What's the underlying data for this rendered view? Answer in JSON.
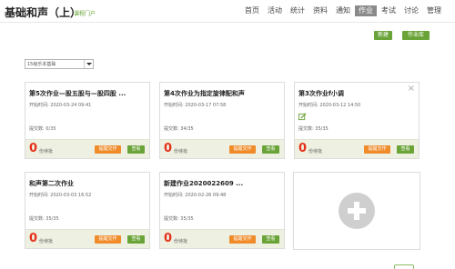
{
  "header": {
    "title": "基础和声（上）",
    "portal_link": "课程门户",
    "nav": [
      "首页",
      "活动",
      "统计",
      "资料",
      "通知",
      "作业",
      "考试",
      "讨论",
      "管理"
    ],
    "active_nav": "作业"
  },
  "toolbar": {
    "new_button": "新建",
    "library_button": "作业库"
  },
  "filter": {
    "selected": "15级乐本基础"
  },
  "labels": {
    "start_time": "开始时间:",
    "submitted": "提交数:",
    "pending": "份待批",
    "remind_button": "提醒交作",
    "view_button": "查看"
  },
  "cards": [
    {
      "title": "第5次作业—股五股与—股四股 ...",
      "start": "2020-03-24 09:41",
      "submitted": "0/35",
      "pending": "0"
    },
    {
      "title": "第4次作业为指定旋律配和声",
      "start": "2020-03-17 07:58",
      "submitted": "34/35",
      "pending": "0"
    },
    {
      "title": "第3次作业f小调",
      "start": "2020-03-12 14:50",
      "submitted": "35/35",
      "pending": "0"
    },
    {
      "title": "和声第二次作业",
      "start": "2020-03-03 16:52",
      "submitted": "35/35",
      "pending": "0"
    },
    {
      "title": "新建作业2020022609 ...",
      "start": "2020-02-26 09:48",
      "submitted": "35/35",
      "pending": "0"
    }
  ],
  "colors": {
    "accent_green": "#6aa338",
    "accent_orange": "#f08b2a",
    "pending_red": "#e5311b",
    "footer_bg": "#eef0e1"
  }
}
